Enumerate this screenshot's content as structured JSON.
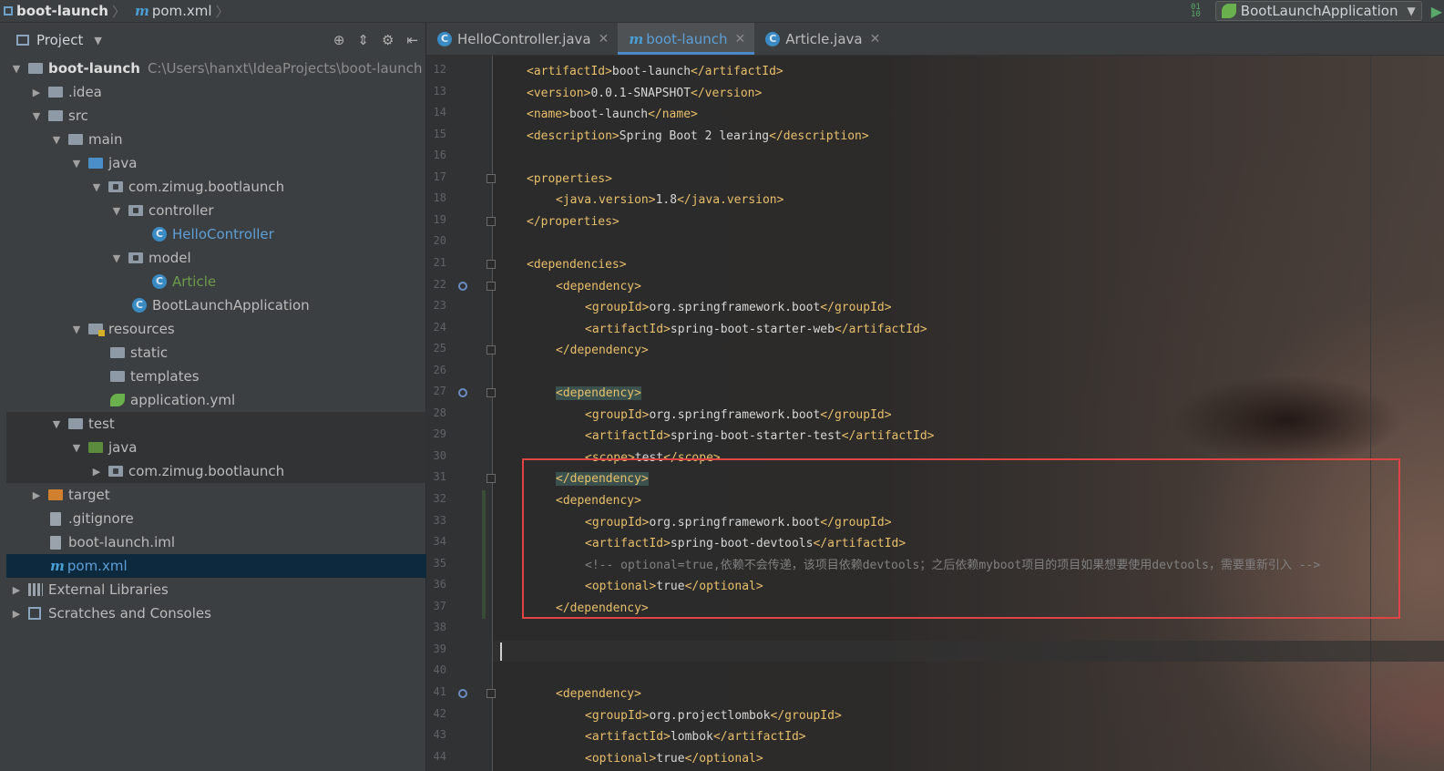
{
  "navbar": {
    "project": "boot-launch",
    "file": "pom.xml",
    "run_config": "BootLaunchApplication"
  },
  "project_panel": {
    "title": "Project",
    "tree": [
      {
        "label": "boot-launch",
        "path": "C:\\Users\\hanxt\\IdeaProjects\\boot-launch"
      },
      {
        "label": ".idea"
      },
      {
        "label": "src"
      },
      {
        "label": "main"
      },
      {
        "label": "java"
      },
      {
        "label": "com.zimug.bootlaunch"
      },
      {
        "label": "controller"
      },
      {
        "label": "HelloController"
      },
      {
        "label": "model"
      },
      {
        "label": "Article"
      },
      {
        "label": "BootLaunchApplication"
      },
      {
        "label": "resources"
      },
      {
        "label": "static"
      },
      {
        "label": "templates"
      },
      {
        "label": "application.yml"
      },
      {
        "label": "test"
      },
      {
        "label": "java"
      },
      {
        "label": "com.zimug.bootlaunch"
      },
      {
        "label": "target"
      },
      {
        "label": ".gitignore"
      },
      {
        "label": "boot-launch.iml"
      },
      {
        "label": "pom.xml"
      },
      {
        "label": "External Libraries"
      },
      {
        "label": "Scratches and Consoles"
      }
    ]
  },
  "tabs": [
    {
      "label": "HelloController.java"
    },
    {
      "label": "boot-launch"
    },
    {
      "label": "Article.java"
    }
  ],
  "editor": {
    "lines": [
      {
        "n": "12",
        "t1": "<artifactId>",
        "v": "boot-launch",
        "t2": "</artifactId>"
      },
      {
        "n": "13",
        "t1": "<version>",
        "v": "0.0.1-SNAPSHOT",
        "t2": "</version>"
      },
      {
        "n": "14",
        "t1": "<name>",
        "v": "boot-launch",
        "t2": "</name>"
      },
      {
        "n": "15",
        "t1": "<description>",
        "v": "Spring Boot 2 learing",
        "t2": "</description>"
      },
      {
        "n": "16",
        "t1": "",
        "v": "",
        "t2": ""
      },
      {
        "n": "17",
        "t1": "<properties>",
        "v": "",
        "t2": ""
      },
      {
        "n": "18",
        "t1": "<java.version>",
        "v": "1.8",
        "t2": "</java.version>"
      },
      {
        "n": "19",
        "t1": "</properties>",
        "v": "",
        "t2": ""
      },
      {
        "n": "20",
        "t1": "",
        "v": "",
        "t2": ""
      },
      {
        "n": "21",
        "t1": "<dependencies>",
        "v": "",
        "t2": ""
      },
      {
        "n": "22",
        "t1": "<dependency>",
        "v": "",
        "t2": ""
      },
      {
        "n": "23",
        "t1": "<groupId>",
        "v": "org.springframework.boot",
        "t2": "</groupId>"
      },
      {
        "n": "24",
        "t1": "<artifactId>",
        "v": "spring-boot-starter-web",
        "t2": "</artifactId>"
      },
      {
        "n": "25",
        "t1": "</dependency>",
        "v": "",
        "t2": ""
      },
      {
        "n": "26",
        "t1": "",
        "v": "",
        "t2": ""
      },
      {
        "n": "27",
        "t1": "<dependency>",
        "v": "",
        "t2": ""
      },
      {
        "n": "28",
        "t1": "<groupId>",
        "v": "org.springframework.boot",
        "t2": "</groupId>"
      },
      {
        "n": "29",
        "t1": "<artifactId>",
        "v": "spring-boot-starter-test",
        "t2": "</artifactId>"
      },
      {
        "n": "30",
        "t1": "<scope>",
        "v": "test",
        "t2": "</scope>"
      },
      {
        "n": "31",
        "t1": "</dependency>",
        "v": "",
        "t2": ""
      },
      {
        "n": "32",
        "t1": "<dependency>",
        "v": "",
        "t2": ""
      },
      {
        "n": "33",
        "t1": "<groupId>",
        "v": "org.springframework.boot",
        "t2": "</groupId>"
      },
      {
        "n": "34",
        "t1": "<artifactId>",
        "v": "spring-boot-devtools",
        "t2": "</artifactId>"
      },
      {
        "n": "35",
        "comment": "<!-- optional=true,依赖不会传递，该项目依赖devtools；之后依赖myboot项目的项目如果想要使用devtools，需要重新引入 -->"
      },
      {
        "n": "36",
        "t1": "<optional>",
        "v": "true",
        "t2": "</optional>"
      },
      {
        "n": "37",
        "t1": "</dependency>",
        "v": "",
        "t2": ""
      },
      {
        "n": "38",
        "t1": "",
        "v": "",
        "t2": ""
      },
      {
        "n": "39",
        "t1": "",
        "v": "",
        "t2": ""
      },
      {
        "n": "40",
        "t1": "",
        "v": "",
        "t2": ""
      },
      {
        "n": "41",
        "t1": "<dependency>",
        "v": "",
        "t2": ""
      },
      {
        "n": "42",
        "t1": "<groupId>",
        "v": "org.projectlombok",
        "t2": "</groupId>"
      },
      {
        "n": "43",
        "t1": "<artifactId>",
        "v": "lombok",
        "t2": "</artifactId>"
      },
      {
        "n": "44",
        "t1": "<optional>",
        "v": "true",
        "t2": "</optional>"
      }
    ]
  }
}
